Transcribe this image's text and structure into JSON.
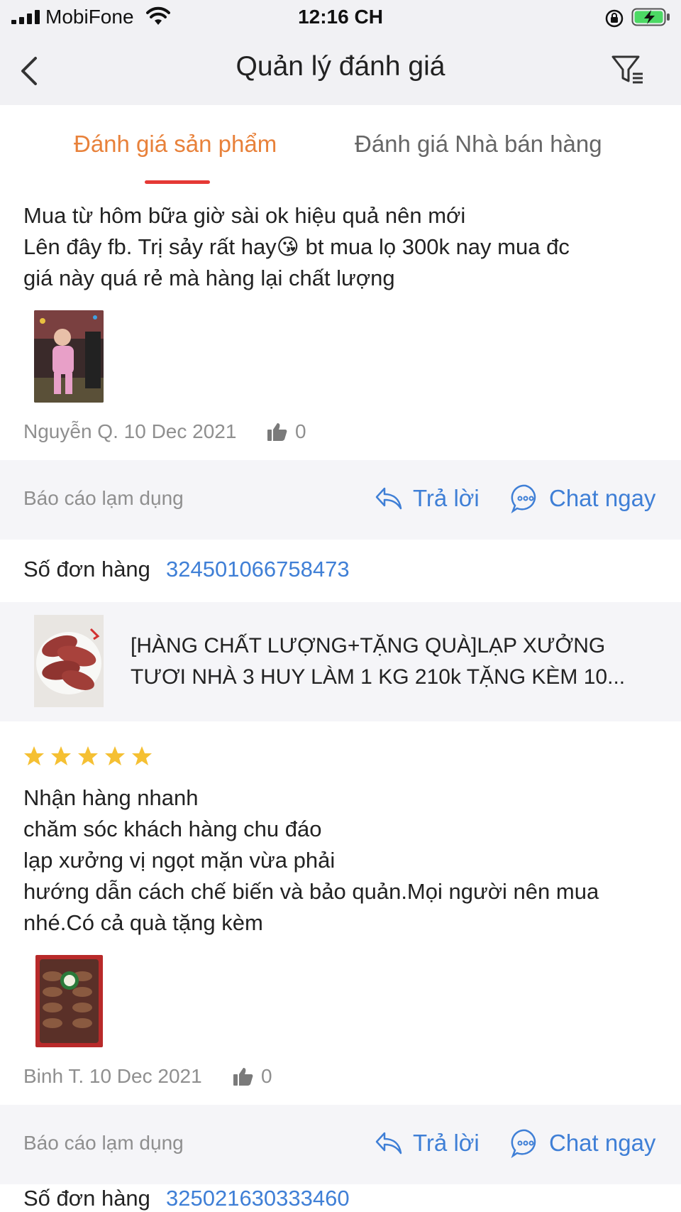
{
  "status_bar": {
    "carrier": "MobiFone",
    "time": "12:16 CH"
  },
  "nav": {
    "title": "Quản lý đánh giá"
  },
  "tabs": [
    {
      "label": "Đánh giá sản phẩm",
      "active": true
    },
    {
      "label": "Đánh giá Nhà bán hàng",
      "active": false
    }
  ],
  "colors": {
    "accent_orange": "#e8813a",
    "tab_underline": "#e53935",
    "link_blue": "#3f7fd6",
    "star_yellow": "#f5c033"
  },
  "reviews": [
    {
      "text_lines": [
        "Mua từ hôm bữa giờ sài ok hiệu quả nên mới",
        "Lên đây fb. Trị sảy rất hay😘 bt mua lọ 300k nay mua đc",
        "giá này quá rẻ mà hàng lại chất lượng"
      ],
      "author": "Nguyễn Q.",
      "date": "10 Dec 2021",
      "likes": "0",
      "report_label": "Báo cáo lạm dụng",
      "reply_label": "Trả lời",
      "chat_label": "Chat ngay",
      "order_label": "Số đơn hàng",
      "order_number": "324501066758473",
      "product_name_line1": "[HÀNG CHẤT LƯỢNG+TẶNG QUÀ]LẠP XƯỞNG",
      "product_name_line2": "TƯƠI NHÀ 3 HUY LÀM 1 KG 210k TẶNG KÈM 10..."
    },
    {
      "rating": 5,
      "text_lines": [
        "Nhận hàng nhanh",
        "chăm sóc khách hàng chu đáo",
        "lạp xưởng vị ngọt mặn vừa phải",
        "hướng dẫn cách chế biến và bảo quản.Mọi người nên mua",
        "nhé.Có cả quà tặng kèm"
      ],
      "author": "Binh T.",
      "date": "10 Dec 2021",
      "likes": "0",
      "report_label": "Báo cáo lạm dụng",
      "reply_label": "Trả lời",
      "chat_label": "Chat ngay",
      "order_label": "Số đơn hàng",
      "order_number": "325021630333460"
    }
  ]
}
